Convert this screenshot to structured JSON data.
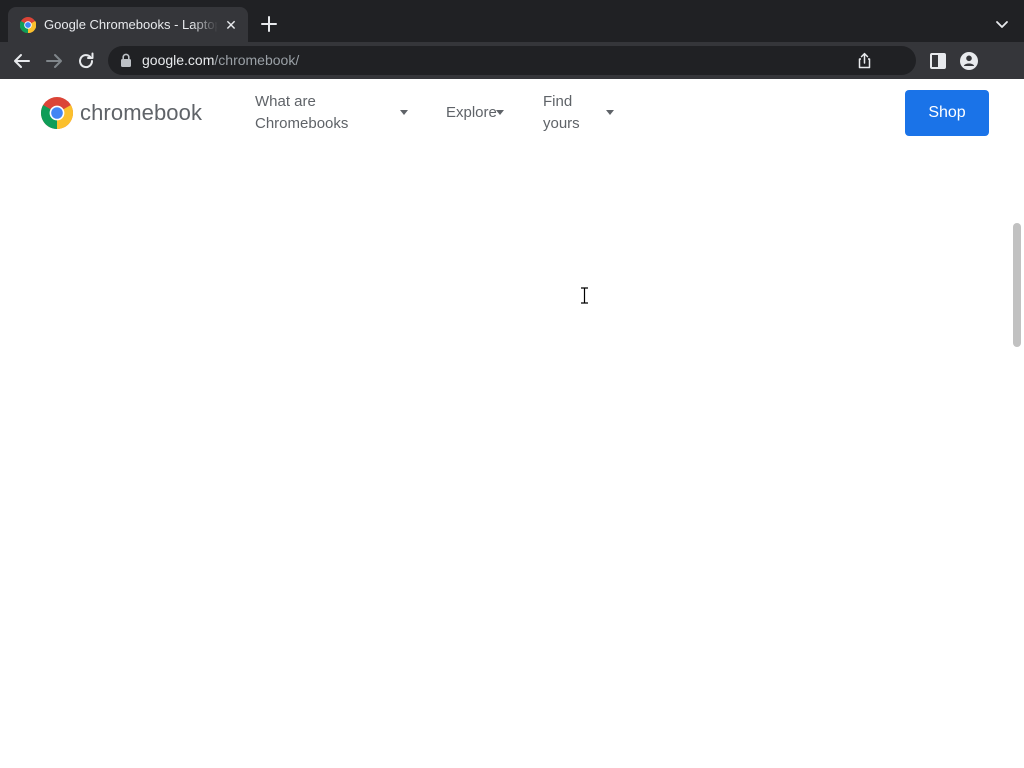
{
  "browser": {
    "tab_title": "Google Chromebooks - Laptops",
    "close_glyph": "✕",
    "url_host": "google.com",
    "url_path": "/chromebook/"
  },
  "site": {
    "logo_text": "chromebook",
    "nav": [
      {
        "label_line1": "What are",
        "label_line2": "Chromebooks"
      },
      {
        "label": "Explore"
      },
      {
        "label_line1": "Find",
        "label_line2": "yours"
      }
    ],
    "shop_label": "Shop"
  },
  "colors": {
    "tabstrip_bg": "#202124",
    "toolbar_bg": "#35363a",
    "accent_blue": "#1a73e8",
    "nav_text": "#5f6368"
  },
  "icons": [
    "chrome-favicon-icon",
    "close-icon",
    "plus-icon",
    "chevron-down-icon",
    "back-arrow-icon",
    "forward-arrow-icon",
    "reload-icon",
    "lock-icon",
    "share-icon",
    "side-panel-icon",
    "profile-icon",
    "chrome-logo-icon",
    "text-cursor-icon"
  ]
}
